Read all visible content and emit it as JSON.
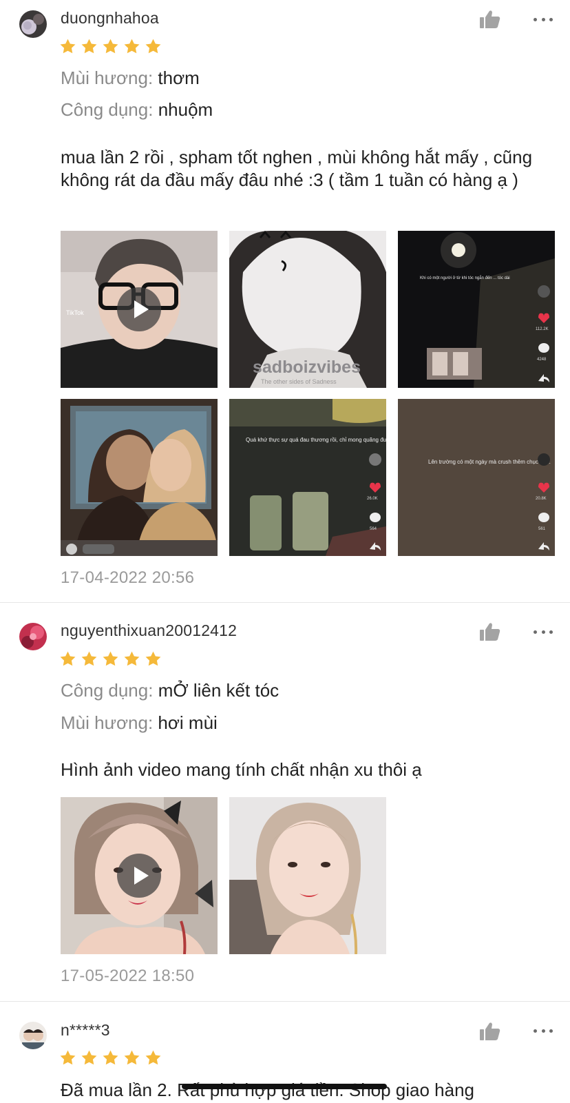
{
  "reviews": [
    {
      "username": "duongnhahoa",
      "rating": 5,
      "attributes": [
        {
          "label": "Mùi hương:",
          "value": "thơm"
        },
        {
          "label": "Công dụng:",
          "value": "nhuộm"
        }
      ],
      "text": "mua lần 2 rồi , spham tốt nghen , mùi không hắt mấy , cũng không rát da đầu mấy đâu nhé :3 ( tầm 1 tuần có hàng ạ )",
      "media": [
        {
          "kind": "video",
          "caption": "TikTok"
        },
        {
          "kind": "image",
          "caption": "sadboizvibes",
          "subcaption": "The other sides of Sadness"
        },
        {
          "kind": "image",
          "caption": "Khi có một người ở từ khi tóc ngắn đến ... tóc dài",
          "stats": [
            "112.2K",
            "4248"
          ]
        },
        {
          "kind": "image",
          "caption": ""
        },
        {
          "kind": "image",
          "caption": "Quá khứ thực sự quá đau thương rồi, chỉ mong quãng đường về sau nhẹ nhàng một chút. Bởi đứa trẻ này chưa từng được dựa vào ai...",
          "stats": [
            "26.0K",
            "564"
          ]
        },
        {
          "kind": "image",
          "caption": "Lên trường có một ngày mà crush thêm chục anh.",
          "stats": [
            "20.8K",
            "561"
          ]
        }
      ],
      "date": "17-04-2022 20:56"
    },
    {
      "username": "nguyenthixuan20012412",
      "rating": 5,
      "attributes": [
        {
          "label": "Công dụng:",
          "value": "mỞ liên kết tóc"
        },
        {
          "label": "Mùi hương:",
          "value": "hơi mùi"
        }
      ],
      "text": "Hình ảnh video mang tính chất nhận xu thôi ạ",
      "media": [
        {
          "kind": "video",
          "caption": ""
        },
        {
          "kind": "image",
          "caption": ""
        }
      ],
      "date": "17-05-2022 18:50"
    },
    {
      "username": "n*****3",
      "rating": 5,
      "attributes": [],
      "text": "Đã mua lần 2. Rất phù hợp giá tiền. Shop giao hàng",
      "media": [],
      "date": ""
    }
  ],
  "icons": {
    "like": "thumbs-up-icon",
    "more": "more-horizontal-icon",
    "star": "star-icon",
    "play": "play-icon"
  },
  "colors": {
    "star": "#f5b93a",
    "muted_label": "#8a8a8a",
    "date": "#9a9a9a",
    "icon_gray": "#a3a3a3",
    "divider": "#e6e6e6",
    "tiktok_heart": "#e8344a"
  }
}
